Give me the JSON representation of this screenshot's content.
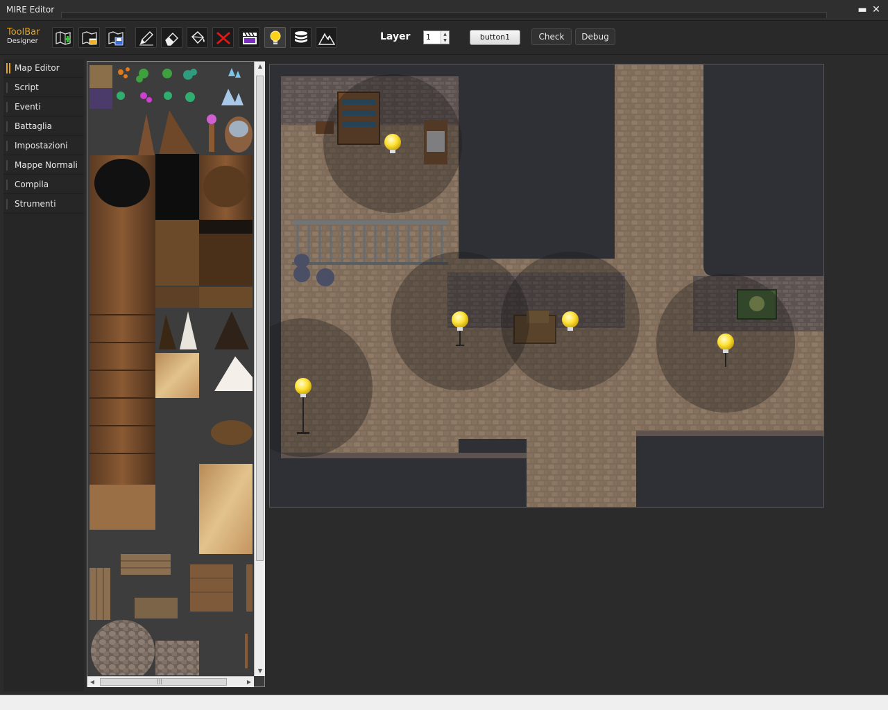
{
  "window": {
    "title": "MIRE Editor",
    "minimize_glyph": "▬",
    "close_glyph": "✕"
  },
  "toolbar": {
    "brand_line1": "ToolBar",
    "brand_line2": "Designer",
    "tools": [
      {
        "name": "new-map-icon"
      },
      {
        "name": "map-properties-icon"
      },
      {
        "name": "save-map-icon"
      },
      {
        "name": "pencil-icon"
      },
      {
        "name": "eraser-icon"
      },
      {
        "name": "fill-bucket-icon"
      },
      {
        "name": "delete-icon"
      },
      {
        "name": "film-clapper-icon"
      },
      {
        "name": "light-bulb-icon"
      },
      {
        "name": "database-icon"
      },
      {
        "name": "mountain-icon"
      }
    ],
    "layer_label": "Layer",
    "layer_value": "1",
    "button1_label": "button1",
    "check_label": "Check",
    "debug_label": "Debug"
  },
  "sidebar": {
    "items": [
      {
        "label": "Map Editor",
        "active": true
      },
      {
        "label": "Script"
      },
      {
        "label": "Eventi"
      },
      {
        "label": "Battaglia"
      },
      {
        "label": "Impostazioni"
      },
      {
        "label": "Mappe Normali"
      },
      {
        "label": "Compila"
      },
      {
        "label": "Strumenti"
      }
    ]
  },
  "colors": {
    "accent": "#e3a51c",
    "background": "#2b2b2b",
    "map_void": "#2f3035",
    "stone": "#8b7562",
    "light": "#ffe33a"
  }
}
